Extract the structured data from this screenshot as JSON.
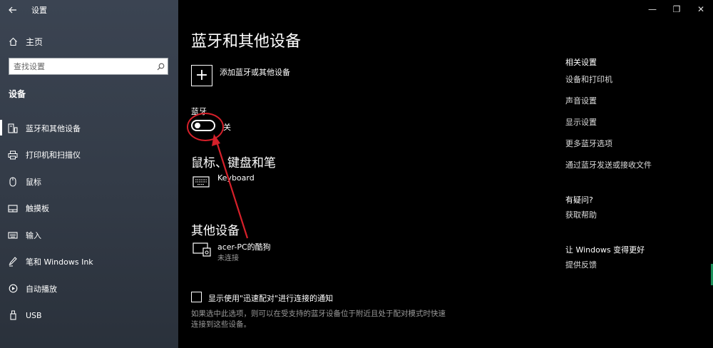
{
  "app": {
    "title": "设置"
  },
  "sidebar": {
    "home_label": "主页",
    "search_placeholder": "查找设置",
    "section_title": "设备",
    "items": [
      {
        "label": "蓝牙和其他设备",
        "icon": "bluetooth-devices-icon",
        "active": true
      },
      {
        "label": "打印机和扫描仪",
        "icon": "printer-icon"
      },
      {
        "label": "鼠标",
        "icon": "mouse-icon"
      },
      {
        "label": "触摸板",
        "icon": "touchpad-icon"
      },
      {
        "label": "输入",
        "icon": "keyboard-icon"
      },
      {
        "label": "笔和 Windows Ink",
        "icon": "pen-icon"
      },
      {
        "label": "自动播放",
        "icon": "autoplay-icon"
      },
      {
        "label": "USB",
        "icon": "usb-icon"
      }
    ]
  },
  "main": {
    "title": "蓝牙和其他设备",
    "add_device_label": "添加蓝牙或其他设备",
    "bluetooth": {
      "label": "蓝牙",
      "state": "关"
    },
    "mouse_keyboard_pen": {
      "title": "鼠标、键盘和笔",
      "devices": [
        {
          "name": "Keyboard",
          "icon": "keyboard-icon"
        }
      ]
    },
    "other_devices": {
      "title": "其他设备",
      "devices": [
        {
          "name": "acer-PC的酷狗",
          "status": "未连接",
          "icon": "media-device-icon"
        }
      ]
    },
    "swift_pair": {
      "label": "显示使用\"迅速配对\"进行连接的通知",
      "description": "如果选中此选项，则可以在受支持的蓝牙设备位于附近且处于配对模式时快速连接到这些设备。",
      "checked": false
    }
  },
  "related": {
    "title": "相关设置",
    "links": [
      "设备和打印机",
      "声音设置",
      "显示设置",
      "更多蓝牙选项",
      "通过蓝牙发送或接收文件"
    ],
    "help_title": "有疑问?",
    "help_link": "获取帮助",
    "feedback_title": "让 Windows 变得更好",
    "feedback_link": "提供反馈"
  },
  "annotation": {
    "color": "#d6202a"
  },
  "colors": {
    "background": "#000000",
    "sidebar": "#353d49",
    "text": "#ffffff",
    "muted": "#9a9a9a"
  }
}
